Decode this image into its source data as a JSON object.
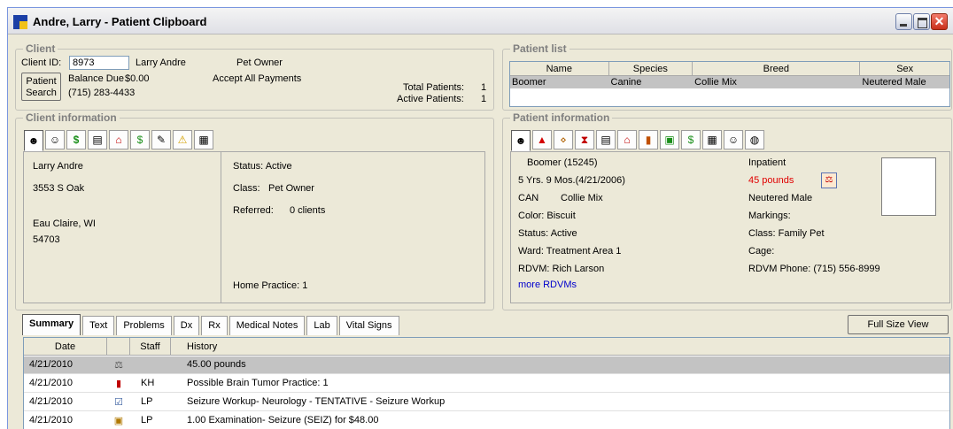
{
  "window": {
    "title": "Andre, Larry - Patient Clipboard"
  },
  "client": {
    "legend": "Client",
    "client_id_label": "Client ID:",
    "client_id": "8973",
    "name": "Larry Andre",
    "role": "Pet Owner",
    "patient_search_line1": "Patient",
    "patient_search_line2": "Search",
    "balance_label": "Balance Due",
    "balance": "$0.00",
    "payments": "Accept All Payments",
    "phone": "(715) 283-4433",
    "total_patients_label": "Total Patients:",
    "total_patients": "1",
    "active_patients_label": "Active Patients:",
    "active_patients": "1"
  },
  "patient_list": {
    "legend": "Patient list",
    "columns": [
      "Name",
      "Species",
      "Breed",
      "Sex"
    ],
    "rows": [
      [
        "Boomer",
        "Canine",
        "Collie Mix",
        "Neutered Male"
      ]
    ]
  },
  "client_info": {
    "legend": "Client information",
    "toolbar_icons": [
      "client-card-icon",
      "contacts-icon",
      "money-icon",
      "document-icon",
      "house-icon",
      "invoice-icon",
      "pen-icon",
      "alert-icon",
      "report-icon"
    ],
    "name": "Larry Andre",
    "address1": "3553 S Oak",
    "city": "Eau Claire, WI",
    "zip": "54703",
    "status": "Status: Active",
    "class_label": "Class:",
    "class_value": "Pet Owner",
    "referred_label": "Referred:",
    "referred_value": "0 clients",
    "home_practice": "Home Practice: 1"
  },
  "patient_info": {
    "legend": "Patient information",
    "toolbar_icons": [
      "patient-card-icon",
      "alert-icon",
      "food-icon",
      "lab-icon",
      "document-icon",
      "house-icon",
      "exam-icon",
      "medication-icon",
      "invoice-icon",
      "report-icon",
      "contacts-icon",
      "globe-icon"
    ],
    "name": "Boomer  (15245)",
    "age": "5 Yrs. 9 Mos.(4/21/2006)",
    "species": "CAN",
    "breed": "Collie Mix",
    "color": "Color:  Biscuit",
    "status": "Status:  Active",
    "ward": "Ward:  Treatment Area 1",
    "rdvm": "RDVM:  Rich Larson",
    "more_rdvms": "more RDVMs",
    "inpatient": "Inpatient",
    "weight": "45 pounds",
    "sex": "Neutered Male",
    "markings": "Markings:",
    "class": "Class:  Family Pet",
    "cage": "Cage:",
    "rdvm_phone": "RDVM Phone: (715) 556-8999"
  },
  "tabs": [
    "Summary",
    "Text",
    "Problems",
    "Dx",
    "Rx",
    "Medical Notes",
    "Lab",
    "Vital Signs"
  ],
  "full_size_view": "Full Size View",
  "history": {
    "columns": [
      "Date",
      "",
      "Staff",
      "History"
    ],
    "rows": [
      {
        "date": "4/21/2010",
        "icon": "scale-icon",
        "staff": "",
        "text": "45.00 pounds"
      },
      {
        "date": "4/21/2010",
        "icon": "problem-icon",
        "staff": "KH",
        "text": "Possible Brain Tumor    Practice: 1"
      },
      {
        "date": "4/21/2010",
        "icon": "workup-icon",
        "staff": "LP",
        "text": "Seizure Workup- Neurology - TENTATIVE - Seizure Workup"
      },
      {
        "date": "4/21/2010",
        "icon": "charge-icon",
        "staff": "LP",
        "text": "1.00 Examination- Seizure (SEIZ) for $48.00"
      }
    ]
  }
}
